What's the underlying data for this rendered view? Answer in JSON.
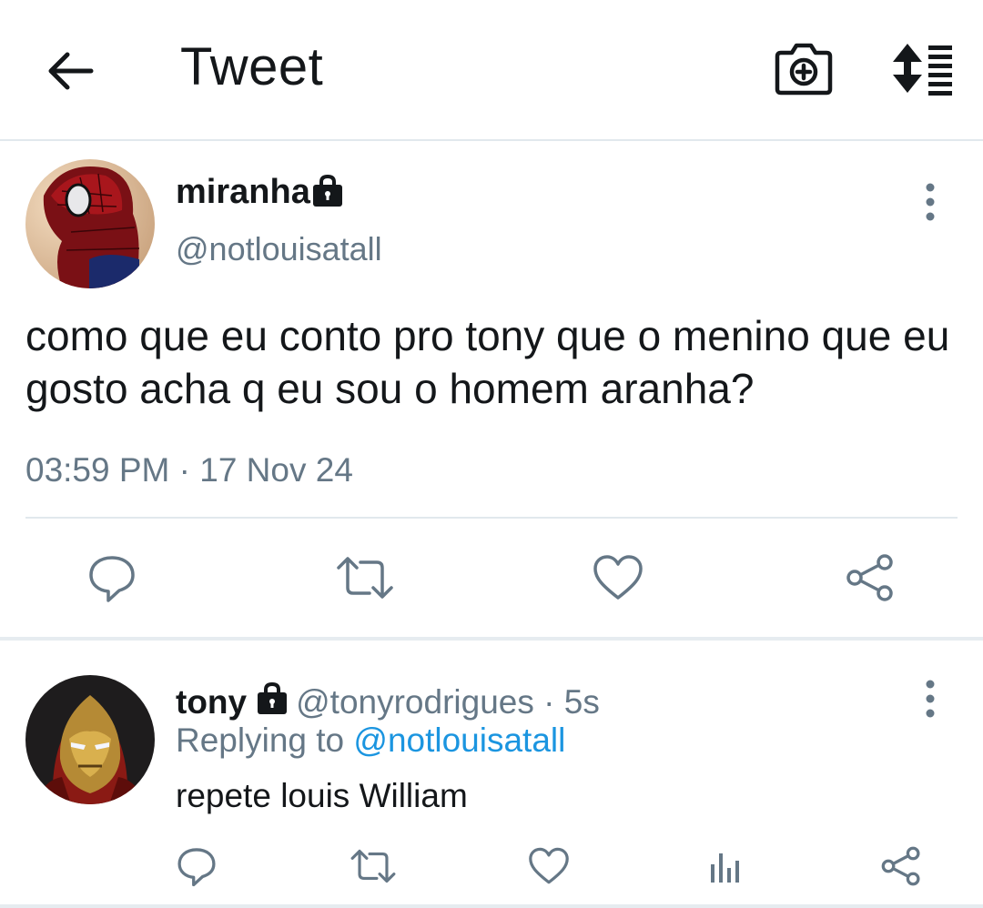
{
  "header": {
    "title": "Tweet",
    "icons": [
      "back-arrow-icon",
      "camera-plus-icon",
      "sort-icon"
    ]
  },
  "tweet": {
    "author_name": "miranha",
    "author_handle": "@notlouisatall",
    "text": "como que eu conto pro tony que o menino que eu gosto acha q eu sou o homem aranha?",
    "timestamp": "03:59 PM · 17 Nov 24",
    "protected_icon": "lock-icon",
    "actions": [
      "reply-icon",
      "retweet-icon",
      "like-icon",
      "share-icon"
    ]
  },
  "reply": {
    "author_name": "tony",
    "author_handle": "@tonyrodrigues",
    "time": " · 5s",
    "replying_prefix": "Replying to ",
    "replying_to": "@notlouisatall",
    "text": "repete louis William",
    "protected_icon": "lock-icon",
    "actions": [
      "reply-icon",
      "retweet-icon",
      "like-icon",
      "analytics-icon",
      "share-icon"
    ]
  },
  "colors": {
    "text": "#14171a",
    "secondary": "#657786",
    "link": "#1b95e0",
    "divider": "#e1e8ed"
  }
}
